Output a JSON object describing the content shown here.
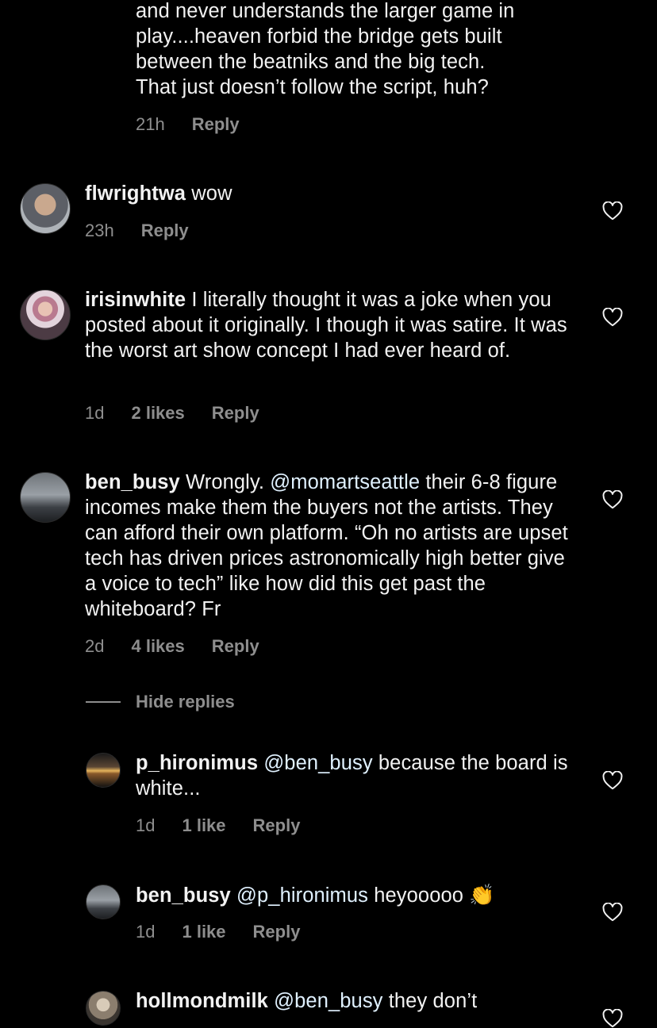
{
  "fragment": {
    "lines": [
      "and never understands the larger game in",
      "play....heaven forbid the bridge gets built",
      "between the beatniks and the big tech.",
      "That just doesn’t follow the script, huh?"
    ],
    "time": "21h",
    "reply_label": "Reply"
  },
  "comments": [
    {
      "username": "flwrightwa",
      "text": "wow",
      "time": "23h",
      "likes": "",
      "reply_label": "Reply"
    },
    {
      "username": "irisinwhite",
      "text": "I literally thought it was a joke when you posted about it originally. I though it was satire. It was the worst art show concept I had ever heard of.",
      "time": "1d",
      "likes": "2 likes",
      "reply_label": "Reply"
    },
    {
      "username": "ben_busy",
      "text_before": "Wrongly.",
      "mention": "@momartseattle",
      "text_after": "their 6-8 figure incomes make them the buyers not the artists. They can afford their own platform. “Oh no artists are upset tech has driven prices astronomically high better give a voice to tech” like how did this get past the whiteboard? Fr",
      "time": "2d",
      "likes": "4 likes",
      "reply_label": "Reply"
    }
  ],
  "hide_replies_label": "Hide replies",
  "replies": [
    {
      "username": "p_hironimus",
      "mention": "@ben_busy",
      "text": "because the board is white...",
      "time": "1d",
      "likes": "1 like",
      "reply_label": "Reply"
    },
    {
      "username": "ben_busy",
      "mention": "@p_hironimus",
      "text": "heyooooo",
      "emoji": "👏",
      "time": "1d",
      "likes": "1 like",
      "reply_label": "Reply"
    },
    {
      "username": "hollmondmilk",
      "mention": "@ben_busy",
      "text": "they don’t"
    }
  ],
  "colors": {
    "background": "#000000",
    "text": "#f2f2f2",
    "secondary": "#8e8e8e",
    "mention": "#e0f1ff"
  },
  "icons": {
    "like": "heart-outline-icon"
  }
}
